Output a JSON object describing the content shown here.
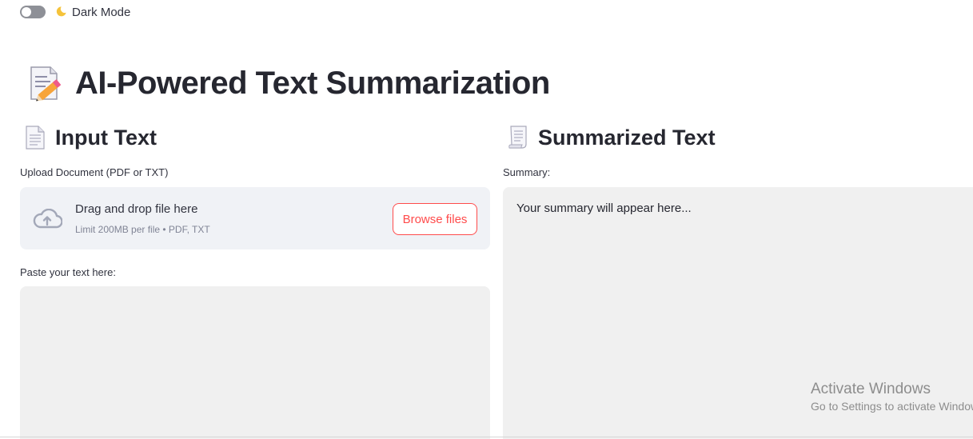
{
  "toggle": {
    "label": "Dark Mode",
    "state": "off",
    "icon": "crescent-moon-icon"
  },
  "header": {
    "title": "AI-Powered Text Summarization",
    "icon": "memo-icon"
  },
  "input_section": {
    "heading": "Input Text",
    "icon": "page-facing-up-icon",
    "upload": {
      "label": "Upload Document (PDF or TXT)",
      "main_text": "Drag and drop file here",
      "sub_text": "Limit 200MB per file • PDF, TXT",
      "button_label": "Browse files",
      "icon": "cloud-upload-icon"
    },
    "paste": {
      "label": "Paste your text here:",
      "value": ""
    }
  },
  "output_section": {
    "heading": "Summarized Text",
    "icon": "page-with-curl-icon",
    "label": "Summary:",
    "placeholder_text": "Your summary will appear here..."
  },
  "watermark": {
    "title": "Activate Windows",
    "subtitle": "Go to Settings to activate Windows."
  },
  "colors": {
    "accent": "#ff4b4b",
    "panel_bg": "#f0f2f6",
    "input_bg": "#f0f0f0",
    "text": "#31333f"
  }
}
